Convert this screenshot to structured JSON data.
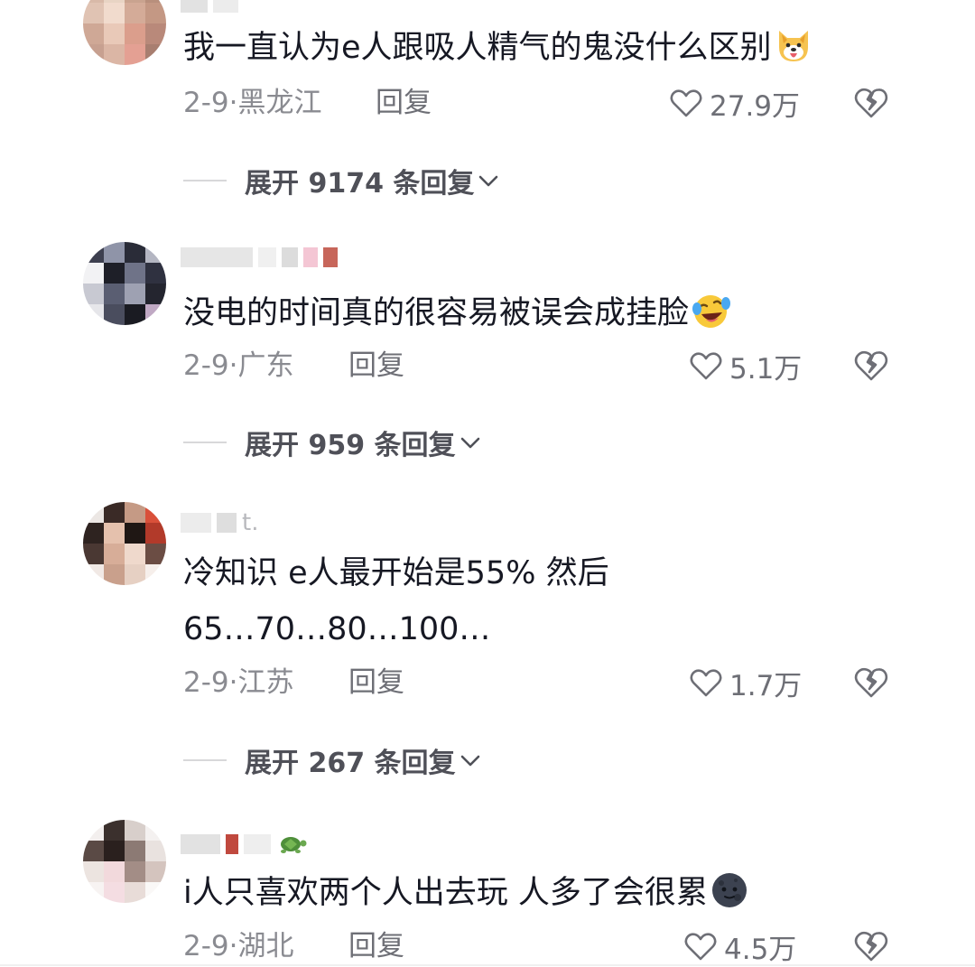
{
  "comments": [
    {
      "text": "我一直认为e人跟吸人精气的鬼没什么区别",
      "date_location": "2-9·黑龙江",
      "reply": "回复",
      "likes": "27.9万",
      "emoji": "dog-emoji",
      "expand": "展开 9174 条回复"
    },
    {
      "text": "没电的时间真的很容易被误会成挂脸",
      "date_location": "2-9·广东",
      "reply": "回复",
      "likes": "5.1万",
      "emoji": "laughing-tears-emoji",
      "expand": "展开 959 条回复"
    },
    {
      "text": "冷知识  e人最开始是55%  然后",
      "text_line2": "65…70…80…100…",
      "date_location": "2-9·江苏",
      "reply": "回复",
      "likes": "1.7万",
      "username_suffix": "t.",
      "expand": "展开 267 条回复"
    },
    {
      "text": "i人只喜欢两个人出去玩  人多了会很累",
      "date_location": "2-9·湖北",
      "reply": "回复",
      "likes": "4.5万",
      "emoji": "dark-moon-emoji"
    }
  ],
  "colors": {
    "text": "#161823",
    "meta": "#8a8b91",
    "icon": "#6e6f76",
    "line": "#d8d8da"
  }
}
